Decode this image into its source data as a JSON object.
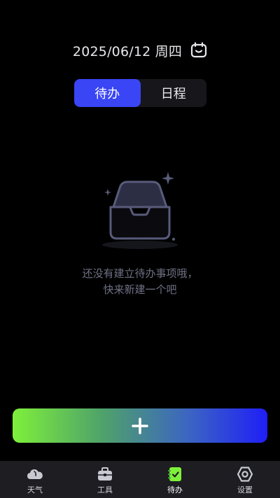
{
  "header": {
    "date": "2025/06/12 周四",
    "calendar_icon": "calendar-icon"
  },
  "segment": {
    "tabs": [
      {
        "label": "待办",
        "active": true
      },
      {
        "label": "日程",
        "active": false
      }
    ],
    "active_color": "#3a45f5"
  },
  "empty_state": {
    "icon": "empty-inbox-icon",
    "line1": "还没有建立待办事项哦，",
    "line2": "快来新建一个吧"
  },
  "add_button": {
    "icon": "plus-icon",
    "gradient": [
      "#7ef03a",
      "#1f1ff6"
    ]
  },
  "bottom_nav": {
    "items": [
      {
        "label": "天气",
        "icon": "cloud-icon"
      },
      {
        "label": "工具",
        "icon": "toolbox-icon"
      },
      {
        "label": "待办",
        "icon": "todo-icon",
        "active": true,
        "accent": "#7ef03a"
      },
      {
        "label": "设置",
        "icon": "settings-hexagon-icon"
      }
    ]
  }
}
